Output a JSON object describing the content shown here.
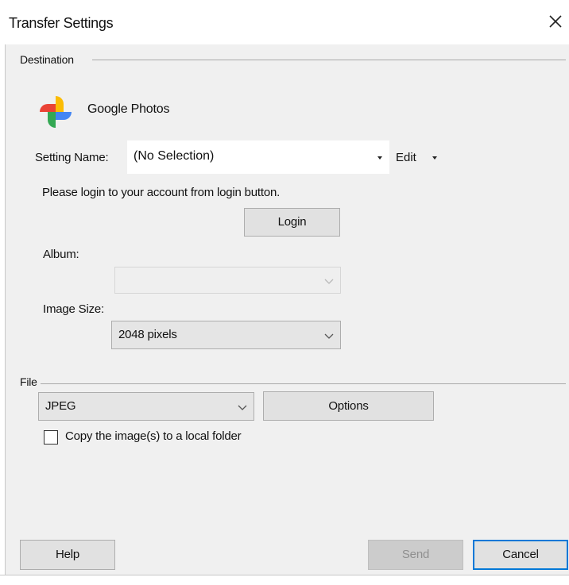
{
  "window": {
    "title": "Transfer Settings",
    "close_icon": "close-icon"
  },
  "destination": {
    "group_label": "Destination",
    "service_icon": "google-photos-pinwheel-icon",
    "service_name": "Google Photos",
    "setting_name_label": "Setting Name:",
    "setting_name_value": "(No Selection)",
    "edit_label": "Edit",
    "login_prompt": "Please login to your account from login button.",
    "login_button": "Login",
    "album_label": "Album:",
    "album_value": "",
    "image_size_label": "Image Size:",
    "image_size_value": "2048 pixels"
  },
  "file": {
    "group_label": "File",
    "format_value": "JPEG",
    "options_button": "Options",
    "copy_checkbox_label": "Copy the image(s) to a local folder",
    "copy_checked": false
  },
  "footer": {
    "help_button": "Help",
    "send_button": "Send",
    "cancel_button": "Cancel"
  },
  "colors": {
    "client_background": "#f0f0f0",
    "default_button_border": "#0078d7",
    "disabled_text": "#8f8f8f",
    "logo_red": "#ea4335",
    "logo_yellow": "#fbbc04",
    "logo_green": "#34a853",
    "logo_blue": "#4285f4"
  }
}
